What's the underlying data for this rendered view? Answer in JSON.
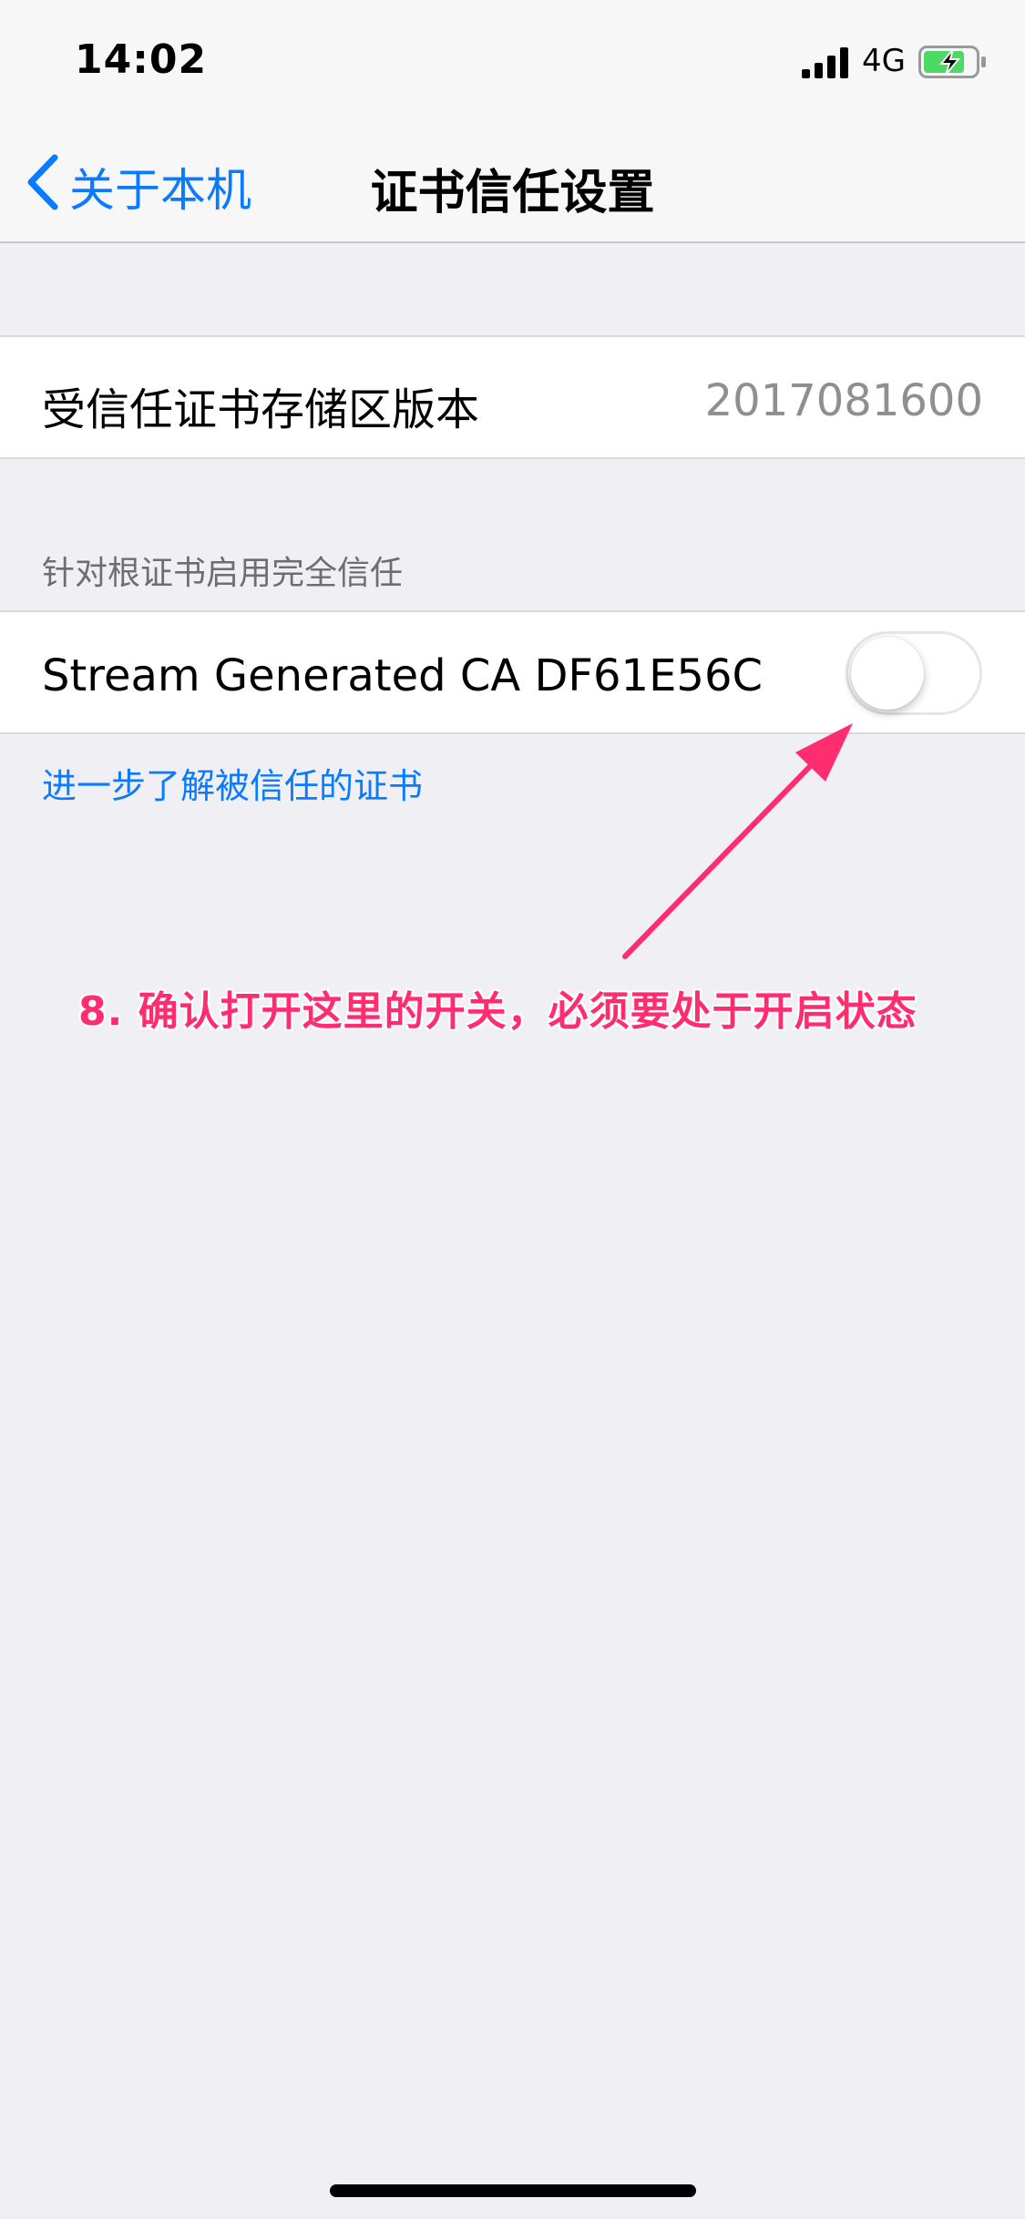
{
  "status_bar": {
    "time": "14:02",
    "network": "4G",
    "battery_color": "#4cd964"
  },
  "nav": {
    "back_label": "关于本机",
    "title": "证书信任设置"
  },
  "trust_store": {
    "label": "受信任证书存储区版本",
    "value": "2017081600"
  },
  "full_trust": {
    "section_header": "针对根证书启用完全信任",
    "certificate_label": "Stream Generated CA DF61E56C",
    "toggle_on": false
  },
  "learn_more_link": "进一步了解被信任的证书",
  "annotation": {
    "text": "8. 确认打开这里的开关，必须要处于开启状态",
    "color": "#ff2d6f"
  },
  "colors": {
    "accent": "#0a7aff",
    "background": "#efeff4",
    "secondary_text": "#8e8e93"
  }
}
